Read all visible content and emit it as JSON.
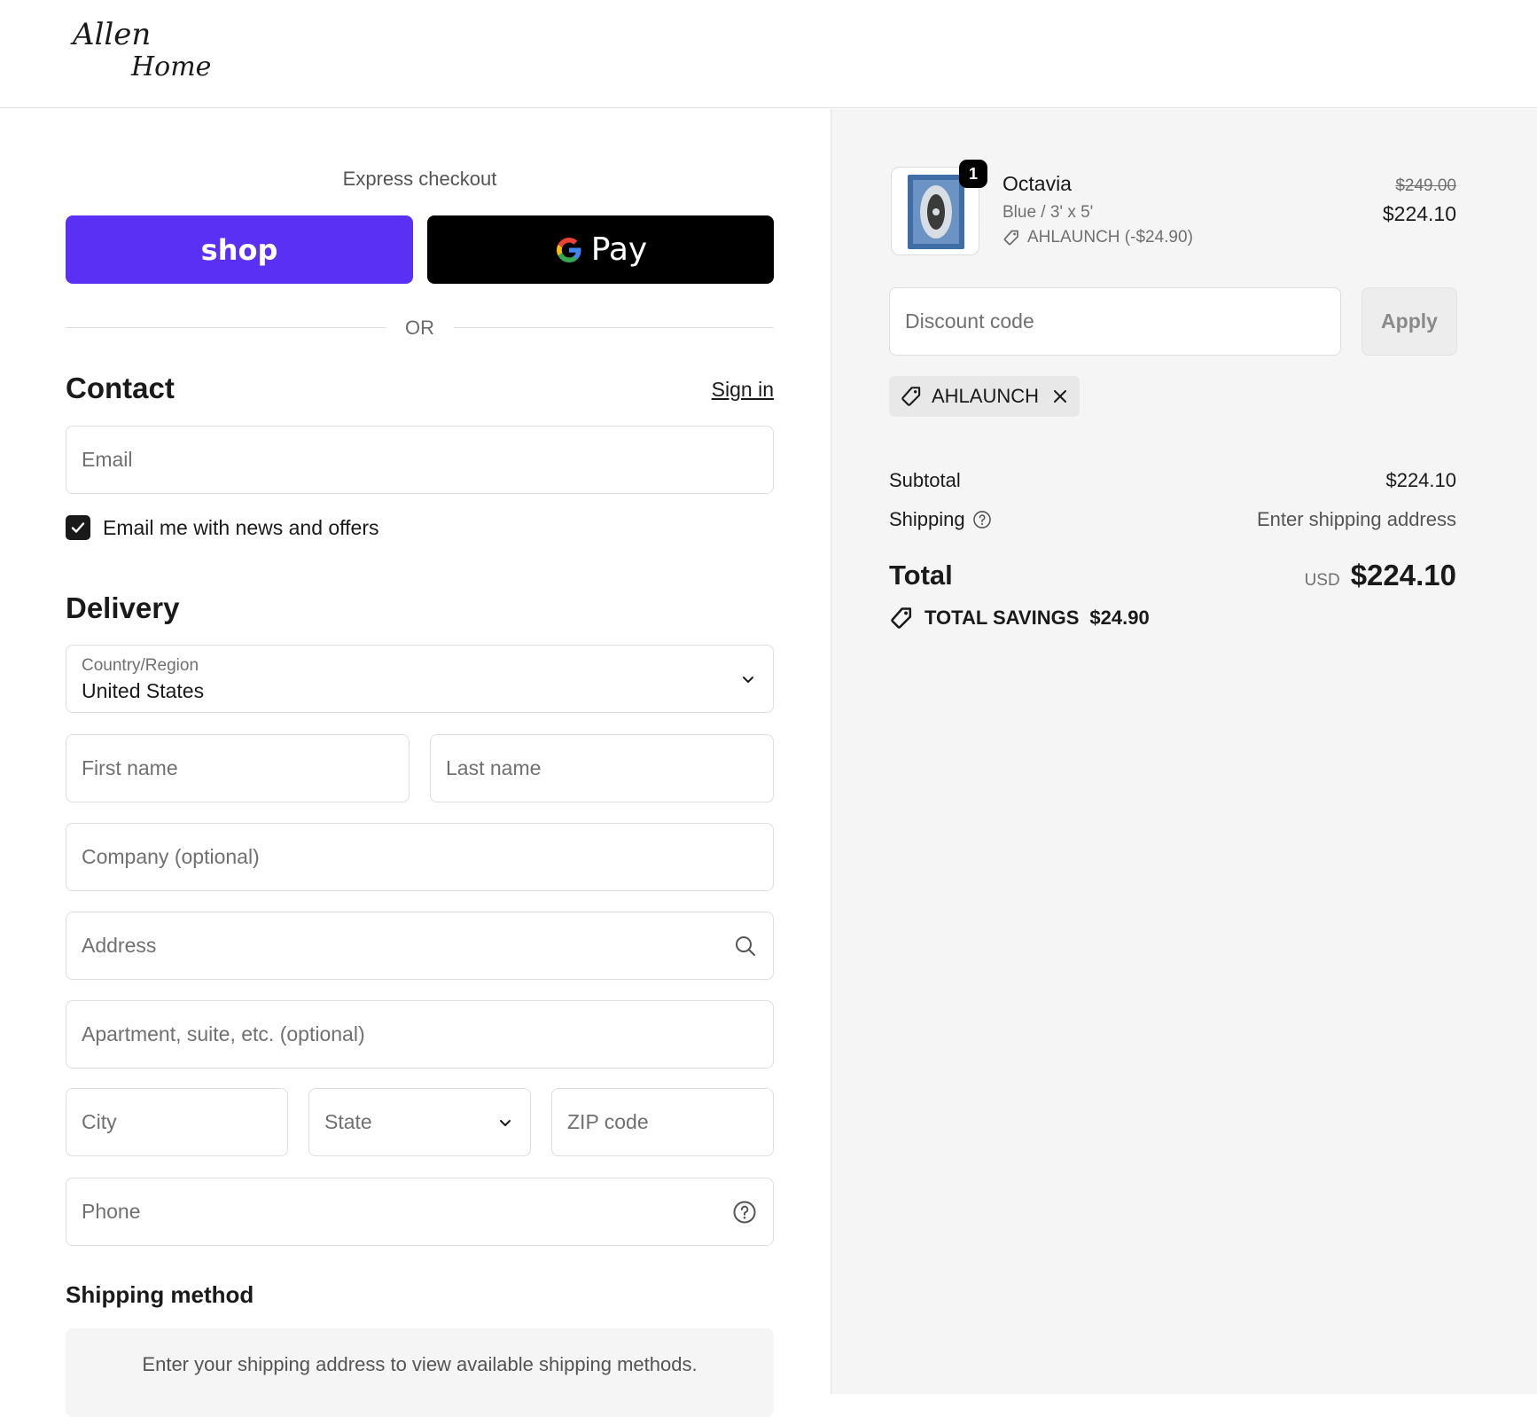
{
  "brand": {
    "logo_line1": "Allen",
    "logo_line2": "Home"
  },
  "express": {
    "label": "Express checkout",
    "shop_label": "shop",
    "gpay_label": "Pay"
  },
  "divider_text": "OR",
  "contact": {
    "title": "Contact",
    "sign_in": "Sign in",
    "email_placeholder": "Email",
    "newsletter_label": "Email me with news and offers",
    "newsletter_checked": true
  },
  "delivery": {
    "title": "Delivery",
    "country_label": "Country/Region",
    "country_value": "United States",
    "first_name_placeholder": "First name",
    "last_name_placeholder": "Last name",
    "company_placeholder": "Company (optional)",
    "address_placeholder": "Address",
    "apartment_placeholder": "Apartment, suite, etc. (optional)",
    "city_placeholder": "City",
    "state_placeholder": "State",
    "zip_placeholder": "ZIP code",
    "phone_placeholder": "Phone"
  },
  "shipping_method": {
    "title": "Shipping method",
    "info": "Enter your shipping address to view available shipping methods."
  },
  "summary": {
    "item": {
      "name": "Octavia",
      "variant": "Blue / 3' x 5'",
      "discount": "AHLAUNCH (-$24.90)",
      "quantity": "1",
      "price_original": "$249.00",
      "price_final": "$224.10"
    },
    "discount_placeholder": "Discount code",
    "apply_label": "Apply",
    "applied_code": "AHLAUNCH",
    "subtotal_label": "Subtotal",
    "subtotal_value": "$224.10",
    "shipping_label": "Shipping",
    "shipping_value": "Enter shipping address",
    "total_label": "Total",
    "currency": "USD",
    "total_value": "$224.10",
    "savings_label": "TOTAL SAVINGS",
    "savings_value": "$24.90"
  },
  "colors": {
    "shop_purple": "#5a31f4",
    "gpay_black": "#000000",
    "summary_bg": "#f5f5f5"
  }
}
